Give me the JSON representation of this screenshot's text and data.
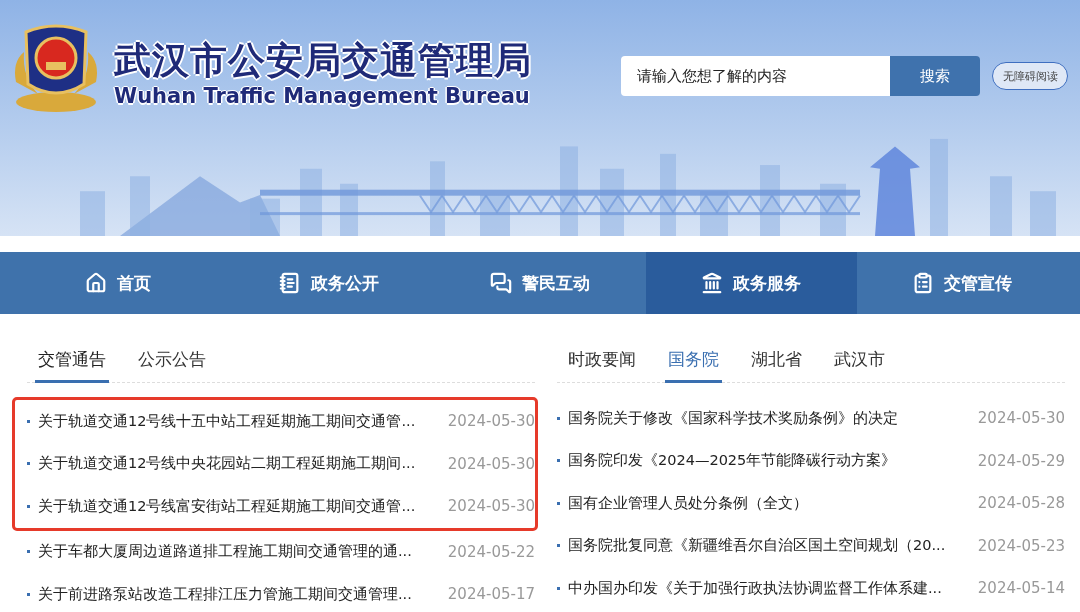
{
  "header": {
    "title_cn": "武汉市公安局交通管理局",
    "title_en": "Wuhan Traffic Management Bureau",
    "search": {
      "placeholder": "请输入您想了解的内容",
      "button": "搜索"
    },
    "accessibility_button": "无障碍阅读"
  },
  "nav": [
    {
      "label": "首页",
      "selected": false
    },
    {
      "label": "政务公开",
      "selected": false
    },
    {
      "label": "警民互动",
      "selected": false
    },
    {
      "label": "政务服务",
      "selected": true
    },
    {
      "label": "交管宣传",
      "selected": false
    }
  ],
  "left_panel": {
    "tabs": [
      {
        "label": "交管通告",
        "selected": true
      },
      {
        "label": "公示公告",
        "selected": false
      }
    ],
    "items": [
      {
        "title": "关于轨道交通12号线十五中站工程延期施工期间交通管...",
        "date": "2024-05-30",
        "highlighted": true
      },
      {
        "title": "关于轨道交通12号线中央花园站二期工程延期施工期间...",
        "date": "2024-05-30",
        "highlighted": true
      },
      {
        "title": "关于轨道交通12号线富安街站工程延期施工期间交通管...",
        "date": "2024-05-30",
        "highlighted": true
      },
      {
        "title": "关于车都大厦周边道路道排工程施工期间交通管理的通...",
        "date": "2024-05-22",
        "highlighted": false
      },
      {
        "title": "关于前进路泵站改造工程排江压力管施工期间交通管理...",
        "date": "2024-05-17",
        "highlighted": false
      }
    ]
  },
  "right_panel": {
    "tabs": [
      {
        "label": "时政要闻",
        "selected": false
      },
      {
        "label": "国务院",
        "selected": true
      },
      {
        "label": "湖北省",
        "selected": false
      },
      {
        "label": "武汉市",
        "selected": false
      }
    ],
    "items": [
      {
        "title": "国务院关于修改《国家科学技术奖励条例》的决定",
        "date": "2024-05-30",
        "highlighted": false
      },
      {
        "title": "国务院印发《2024—2025年节能降碳行动方案》",
        "date": "2024-05-29",
        "highlighted": false
      },
      {
        "title": "国有企业管理人员处分条例（全文）",
        "date": "2024-05-28",
        "highlighted": false
      },
      {
        "title": "国务院批复同意《新疆维吾尔自治区国土空间规划（20...",
        "date": "2024-05-23",
        "highlighted": false
      },
      {
        "title": "中办国办印发《关于加强行政执法协调监督工作体系建...",
        "date": "2024-05-14",
        "highlighted": false
      }
    ]
  }
}
